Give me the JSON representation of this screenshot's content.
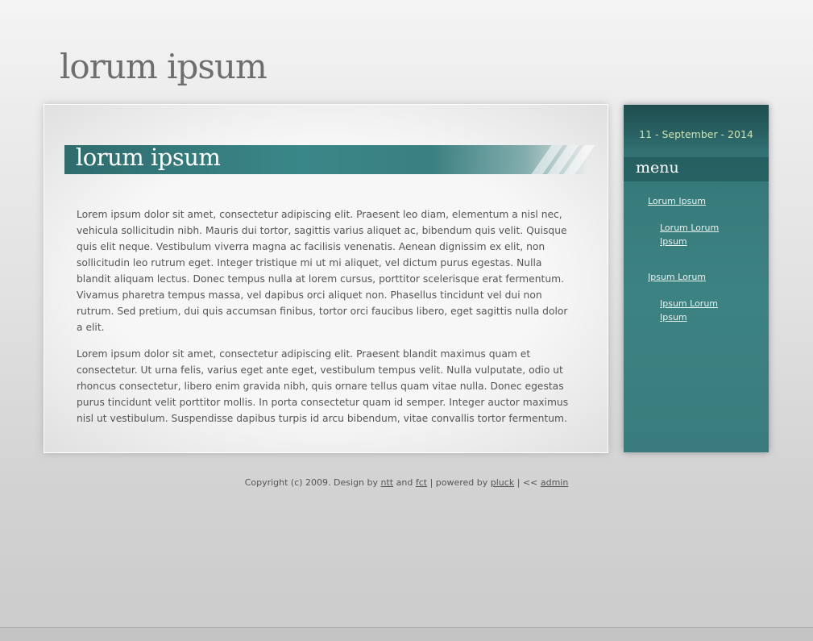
{
  "site": {
    "title": "lorum ipsum"
  },
  "main": {
    "heading": "lorum ipsum",
    "paragraphs": [
      "Lorem ipsum dolor sit amet, consectetur adipiscing elit. Praesent leo diam, elementum a nisl nec, vehicula sollicitudin nibh. Mauris dui tortor, sagittis varius aliquet ac, bibendum quis velit. Quisque quis elit neque. Vestibulum viverra magna ac facilisis venenatis. Aenean dignissim ex elit, non sollicitudin leo rutrum eget. Integer tristique mi ut mi aliquet, vel dictum purus egestas. Nulla blandit aliquam lectus. Donec tempus nulla at lorem cursus, porttitor scelerisque erat fermentum. Vivamus pharetra tempus massa, vel dapibus orci aliquet non. Phasellus tincidunt vel dui non rutrum. Sed pretium, dui quis accumsan finibus, tortor orci faucibus libero, eget sagittis nulla dolor a elit.",
      "Lorem ipsum dolor sit amet, consectetur adipiscing elit. Praesent blandit maximus quam et consectetur. Ut urna felis, varius eget ante eget, vestibulum tempus velit. Nulla vulputate, odio ut rhoncus consectetur, libero enim gravida nibh, quis ornare tellus quam vitae nulla. Donec egestas purus tincidunt velit porttitor mollis. In porta consectetur quam id semper. Integer auctor maximus nisl ut vestibulum. Suspendisse dapibus turpis id arcu bibendum, vitae convallis tortor fermentum."
    ]
  },
  "sidebar": {
    "date": "11 - September - 2014",
    "menu_heading": "menu",
    "items": [
      {
        "label": "Lorum Ipsum"
      },
      {
        "label": "Lorum Lorum Ipsum"
      },
      {
        "label": "Ipsum Lorum"
      },
      {
        "label": "Ipsum Lorum Ipsum"
      }
    ]
  },
  "footer": {
    "text_copyright": "Copyright (c) 2009. Design by",
    "link_ntt": "ntt",
    "text_and": "and",
    "link_fct": "fct",
    "text_powered": "| powered by",
    "link_pluck": "pluck",
    "text_sep": "| <<",
    "link_admin": "admin"
  },
  "colors": {
    "accent_teal": "#3a7f80",
    "date_text": "#cfe3b0",
    "body_text": "#555555",
    "title_text": "#6e6e6e"
  }
}
